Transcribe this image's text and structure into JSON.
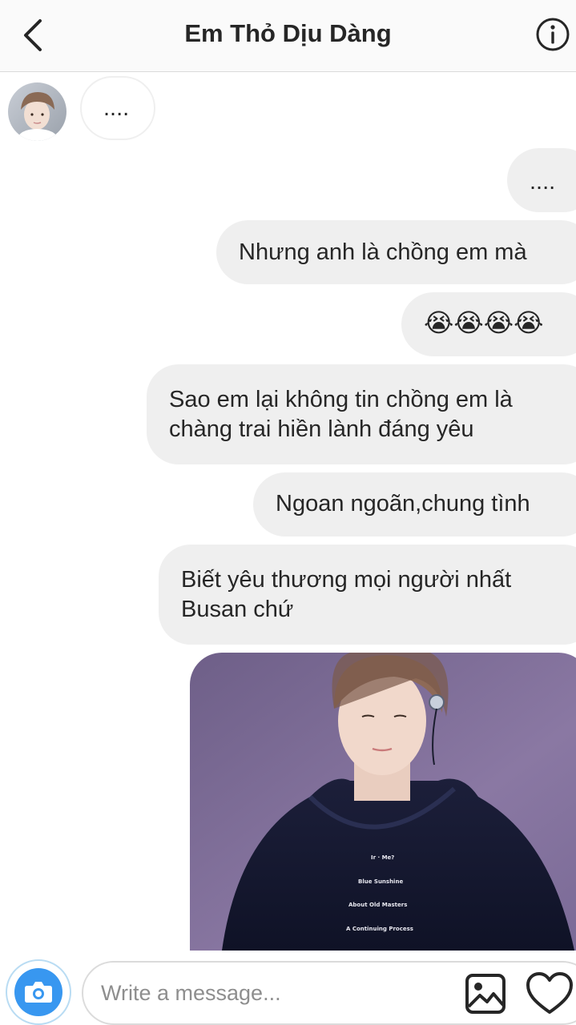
{
  "header": {
    "title": "Em Thỏ Dịu Dàng",
    "back_icon": "chevron-left-icon",
    "info_icon": "info-icon"
  },
  "messages": [
    {
      "sender": "contact",
      "text": "...."
    },
    {
      "sender": "me",
      "text": "...."
    },
    {
      "sender": "me",
      "text": "Nhưng anh là chồng em mà"
    },
    {
      "sender": "me",
      "text": "😭😭😭😭"
    },
    {
      "sender": "me",
      "lines": [
        "Sao em lại không tin chồng em là",
        "chàng trai hiền lành đáng yêu"
      ]
    },
    {
      "sender": "me",
      "text": "Ngoan ngoãn,chung tình"
    },
    {
      "sender": "me",
      "lines": [
        "Biết yêu thương mọi người nhất",
        "Busan chứ"
      ]
    },
    {
      "sender": "me",
      "type": "photo",
      "hoodie_text": [
        "Ir · Me?",
        "Blue Sunshine",
        "About Old Masters",
        "A Continuing Process"
      ]
    }
  ],
  "composer": {
    "placeholder": "Write a message...",
    "value": "",
    "camera_icon": "camera-icon",
    "gallery_icon": "image-icon",
    "heart_icon": "heart-icon"
  },
  "colors": {
    "accent": "#3897f0",
    "bubble_out": "#efefef",
    "text": "#262626"
  }
}
